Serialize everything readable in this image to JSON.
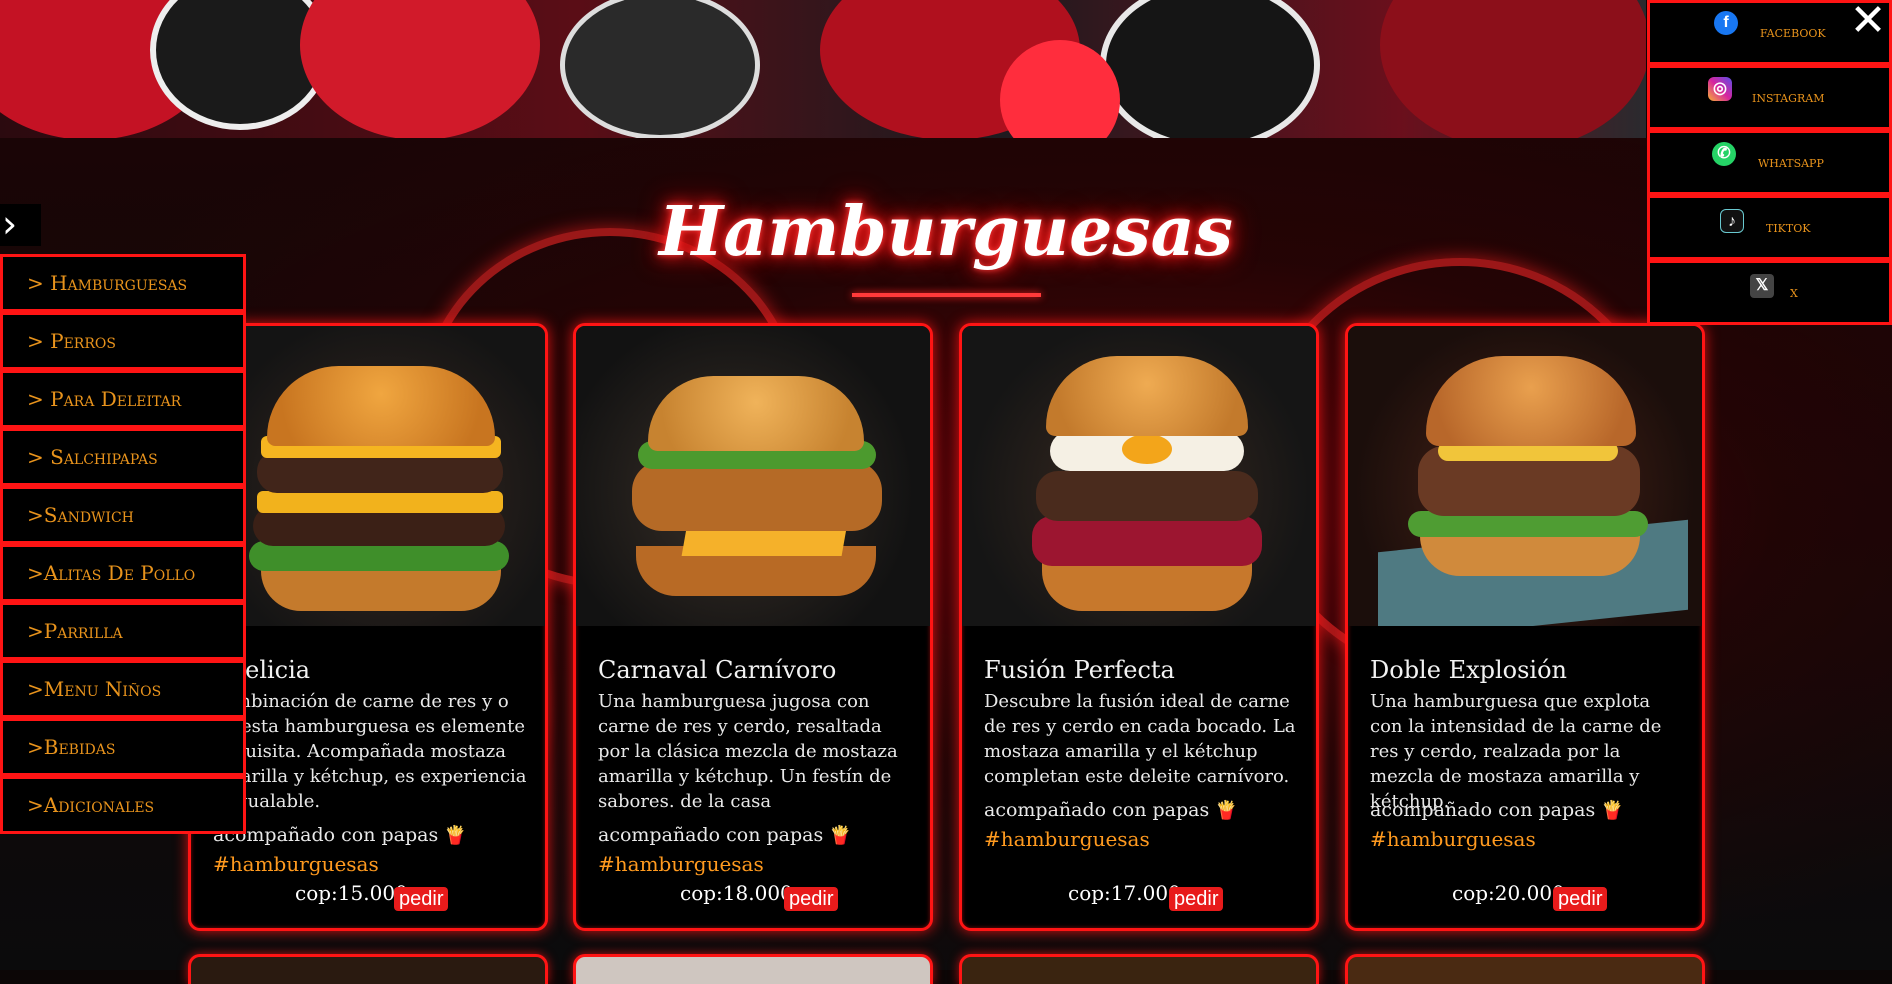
{
  "section": {
    "title": "Hamburguesas"
  },
  "menu_toggle": "›",
  "categories": [
    {
      "label": "> Hamburguesas"
    },
    {
      "label": "> Perros"
    },
    {
      "label": "> Para Deleitar"
    },
    {
      "label": "> Salchipapas"
    },
    {
      "label": ">Sandwich"
    },
    {
      "label": ">Alitas De Pollo"
    },
    {
      "label": ">Parrilla"
    },
    {
      "label": ">Menu Niños"
    },
    {
      "label": ">Bebidas"
    },
    {
      "label": ">Adicionales"
    }
  ],
  "social": [
    {
      "label": "facebook",
      "icon": "facebook-icon",
      "color": "#1877f2",
      "glyph": "f"
    },
    {
      "label": "instagram",
      "icon": "instagram-icon",
      "color": "#d6249f",
      "glyph": "◎"
    },
    {
      "label": "whatsapp",
      "icon": "whatsapp-icon",
      "color": "#25d366",
      "glyph": "✆"
    },
    {
      "label": "tiktok",
      "icon": "tiktok-icon",
      "color": "#111111",
      "glyph": "♪"
    },
    {
      "label": "x",
      "icon": "x-icon",
      "color": "#444444",
      "glyph": "𝕏"
    }
  ],
  "close_label": "✕",
  "products": [
    {
      "name": "Doble Delicia",
      "name_visible": "ble Delicia",
      "description": "combinación de carne de res y o en esta hamburguesa es elemente exquisita. Acompañada mostaza amarilla y kétchup, es experiencia inigualable.",
      "side": "acompañado con papas",
      "side_icon": "🍟",
      "tag": "#hamburguesas",
      "price": "cop:15.000",
      "order_label": "pedir"
    },
    {
      "name": "Carnaval Carnívoro",
      "description": "Una hamburguesa jugosa con carne de res y cerdo, resaltada por la clásica mezcla de mostaza amarilla y kétchup. Un festín de sabores. de la casa",
      "side": "acompañado con papas",
      "side_icon": "🍟",
      "tag": "#hamburguesas",
      "price": "cop:18.000",
      "order_label": "pedir"
    },
    {
      "name": "Fusión Perfecta",
      "description": "Descubre la fusión ideal de carne de res y cerdo en cada bocado. La mostaza amarilla y el kétchup completan este deleite carnívoro.",
      "side": "acompañado con papas",
      "side_icon": "🍟",
      "tag": "#hamburguesas",
      "price": "cop:17.000",
      "order_label": "pedir"
    },
    {
      "name": "Doble Explosión",
      "description": "Una hamburguesa que explota con la intensidad de la carne de res y cerdo, realzada por la mezcla de mostaza amarilla y kétchup.",
      "side": "acompañado con papas",
      "side_icon": "🍟",
      "tag": "#hamburguesas",
      "price": "cop:20.000",
      "order_label": "pedir"
    }
  ],
  "colors": {
    "accent": "#ff1414",
    "category_text": "#e8931c",
    "hashtag": "#ff9a1f",
    "order_button": "#e81b1b"
  }
}
